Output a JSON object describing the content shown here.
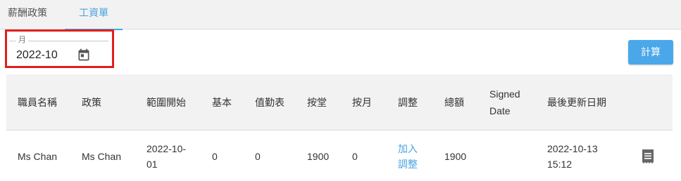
{
  "tabs": [
    {
      "label": "薪酬政策"
    },
    {
      "label": "工資單"
    }
  ],
  "month_field": {
    "label": "月",
    "value": "2022-10"
  },
  "calculate_button": {
    "label": "計算"
  },
  "table": {
    "headers": [
      "職員名稱",
      "政策",
      "範圍開始",
      "基本",
      "值勤表",
      "按堂",
      "按月",
      "調整",
      "總額",
      "Signed Date",
      "最後更新日期"
    ],
    "rows": [
      {
        "staff_name": "Ms Chan",
        "policy": "Ms Chan",
        "range_start": "2022-10-01",
        "basic": "0",
        "roster": "0",
        "per_lesson": "1900",
        "per_month": "0",
        "adjustment": "加入調整",
        "total": "1900",
        "signed_date": "",
        "last_updated": "2022-10-13 15:12"
      }
    ]
  },
  "icons": {
    "calendar": "calendar-icon",
    "document": "document-icon"
  },
  "colors": {
    "accent": "#4aa3e0",
    "button": "#4aa8ea",
    "highlight_border": "#e0201c"
  }
}
